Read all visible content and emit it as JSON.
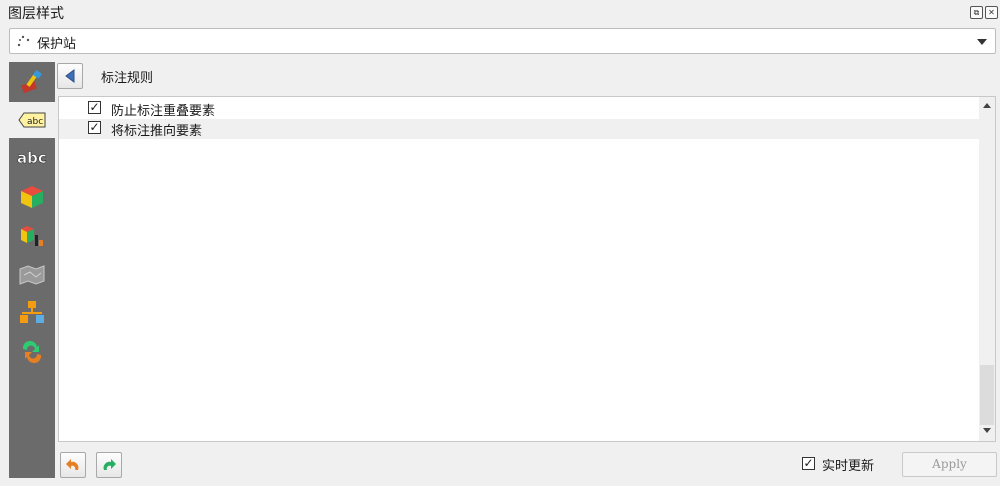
{
  "panel": {
    "title": "图层样式",
    "float_glyph": "⧉",
    "close_glyph": "✕"
  },
  "layer_selector": {
    "selected": "保护站",
    "icon": "point-layer-icon"
  },
  "sidebar": {
    "items": [
      {
        "name": "symbology",
        "icon": "brush-icon"
      },
      {
        "name": "labels",
        "icon": "abc-label-icon"
      },
      {
        "name": "masks",
        "icon": "abc-mask-icon"
      },
      {
        "name": "3d-view",
        "icon": "cube-icon"
      },
      {
        "name": "diagrams",
        "icon": "diagram-icon"
      },
      {
        "name": "rendering",
        "icon": "map-icon"
      },
      {
        "name": "fields",
        "icon": "hierarchy-icon"
      },
      {
        "name": "history",
        "icon": "history-icon"
      }
    ]
  },
  "header": {
    "back_icon": "back-arrow-icon",
    "title": "标注规则"
  },
  "rules": [
    {
      "label": "防止标注重叠要素",
      "checked": true
    },
    {
      "label": "将标注推向要素",
      "checked": true
    }
  ],
  "checkmark": "✓",
  "footer": {
    "undo_icon": "undo-icon",
    "redo_icon": "redo-icon",
    "live_update_label": "实时更新",
    "live_update_checked": true,
    "apply_label": "Apply"
  }
}
